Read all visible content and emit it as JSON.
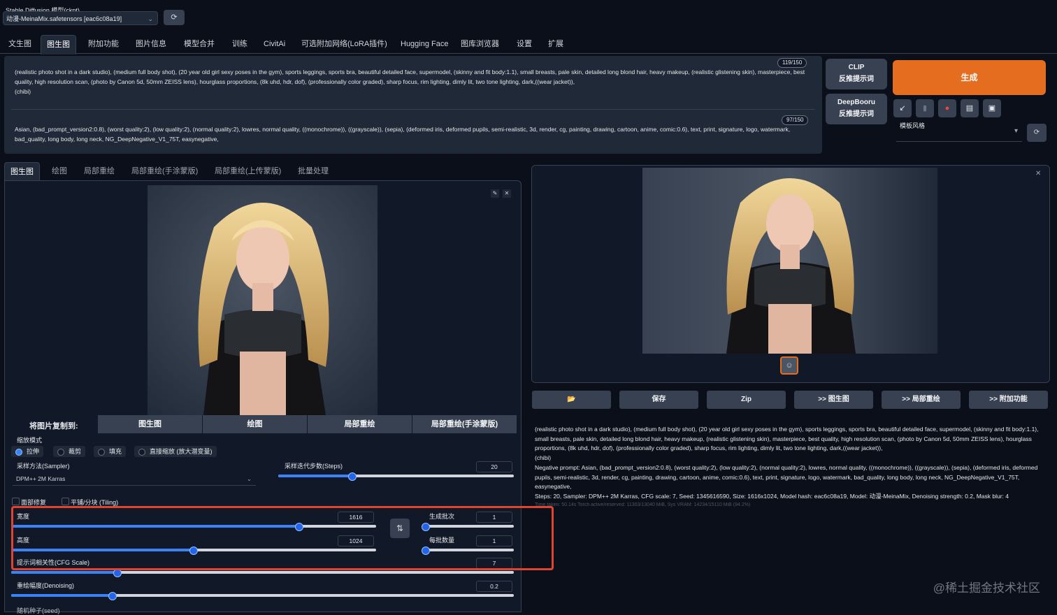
{
  "checkpoint": {
    "label": "Stable Diffusion 模型(ckpt)",
    "value": "动漫-MeinaMix.safetensors [eac6c08a19]"
  },
  "main_tabs": [
    "文生图",
    "图生图",
    "附加功能",
    "图片信息",
    "模型合并",
    "训练",
    "CivitAi",
    "可选附加网络(LoRA插件)",
    "Hugging Face",
    "图库浏览器",
    "设置",
    "扩展"
  ],
  "prompt": {
    "positive": "(realistic photo shot in a dark studio), (medium full body shot), (20 year old girl sexy poses in the gym), sports leggings, sports bra, beautiful detailed face, supermodel, (skinny and fit body:1.1), small breasts, pale skin, detailed long blond hair, heavy makeup, (realistic glistening skin), masterpiece, best quality, high resolution scan, (photo by Canon 5d, 50mm ZEISS lens), hourglass proportions, (8k uhd, hdr, dof), (professionally color graded), sharp focus, rim lighting, dimly lit, two tone lighting, dark,((wear jacket)),",
    "positive_line3": "(chibi)",
    "positive_counter": "119/150",
    "negative": "Asian, (bad_prompt_version2:0.8), (worst quality:2), (low quality:2), (normal quality:2), lowres, normal quality, ((monochrome)), ((grayscale)), (sepia), (deformed iris, deformed pupils, semi-realistic, 3d, render, cg, painting, drawing, cartoon, anime, comic:0.6), text, print, signature, logo, watermark, bad_quality, long body, long neck, NG_DeepNegative_V1_75T, easynegative,",
    "negative_counter": "97/150"
  },
  "interrogate": {
    "clip_line1": "CLIP",
    "clip_line2": "反推提示词",
    "deepbooru_line1": "DeepBooru",
    "deepbooru_line2": "反推提示词"
  },
  "generate_label": "生成",
  "toolbar_icons": [
    "arrow-icon",
    "trash-icon",
    "style-icon",
    "clipboard-icon",
    "save-icon"
  ],
  "styles_label": "模板风格",
  "sub_tabs": [
    "图生图",
    "绘图",
    "局部重绘",
    "局部重绘(手涂蒙版)",
    "局部重绘(上传蒙版)",
    "批量处理"
  ],
  "copy_to": {
    "label": "将图片复制到:",
    "buttons": [
      "图生图",
      "绘图",
      "局部重绘",
      "局部重绘(手涂蒙版)"
    ]
  },
  "resize_mode": {
    "label": "缩放模式",
    "options": [
      "拉伸",
      "裁剪",
      "填充",
      "直接缩放 (放大潜变量)"
    ],
    "selected": "拉伸"
  },
  "sampler": {
    "label": "采样方法(Sampler)",
    "value": "DPM++ 2M Karras"
  },
  "steps": {
    "label": "采样迭代步数(Steps)",
    "value": "20",
    "fraction": 0.313
  },
  "checkboxes": {
    "restore_faces": "面部修复",
    "tiling": "平铺/分块 (Tiling)"
  },
  "width": {
    "label": "宽度",
    "value": "1616",
    "fraction": 0.787
  },
  "height": {
    "label": "高度",
    "value": "1024",
    "fraction": 0.497
  },
  "batch_count": {
    "label": "生成批次",
    "value": "1",
    "fraction": 0.0
  },
  "batch_size": {
    "label": "每批数量",
    "value": "1",
    "fraction": 0.0
  },
  "cfg_scale": {
    "label": "提示词相关性(CFG Scale)",
    "value": "7",
    "fraction": 0.21
  },
  "denoising": {
    "label": "重绘幅度(Denoising)",
    "value": "0.2",
    "fraction": 0.2
  },
  "seed_label": "随机种子(seed)",
  "output_buttons": [
    "📂",
    "保存",
    "Zip",
    ">> 图生图",
    ">> 局部重绘",
    ">> 附加功能"
  ],
  "output_info": {
    "prompt": "(realistic photo shot in a dark studio), (medium full body shot), (20 year old girl sexy poses in the gym), sports leggings, sports bra, beautiful detailed face, supermodel, (skinny and fit body:1.1), small breasts, pale skin, detailed long blond hair, heavy makeup, (realistic glistening skin), masterpiece, best quality, high resolution scan, (photo by Canon 5d, 50mm ZEISS lens), hourglass proportions, (8k uhd, hdr, dof), (professionally color graded), sharp focus, rim lighting, dimly lit, two tone lighting, dark,((wear jacket)),",
    "prompt_line2": "(chibi)",
    "negative": "Negative prompt: Asian, (bad_prompt_version2:0.8), (worst quality:2), (low quality:2), (normal quality:2), lowres, normal quality, ((monochrome)), ((grayscale)), (sepia), (deformed iris, deformed pupils, semi-realistic, 3d, render, cg, painting, drawing, cartoon, anime, comic:0.6), text, print, signature, logo, watermark, bad_quality, long body, long neck, NG_DeepNegative_V1_75T, easynegative,",
    "params": "Steps: 20, Sampler: DPM++ 2M Karras, CFG scale: 7, Seed: 1345616590, Size: 1616x1024, Model hash: eac6c08a19, Model: 动漫-MeinaMix, Denoising strength: 0.2, Mask blur: 4",
    "stats": "Time taken: 50.14s  Torch active/reserved: 11303/13040 MiB, Sys VRAM: 14234/15110 MiB (94.2%)"
  },
  "watermark": "@稀土掘金技术社区",
  "colors": {
    "background": "#0b0f19",
    "panel": "#1f2937",
    "accent": "#e56d1f",
    "slider": "#3b82f6",
    "highlight": "#e0442f"
  }
}
